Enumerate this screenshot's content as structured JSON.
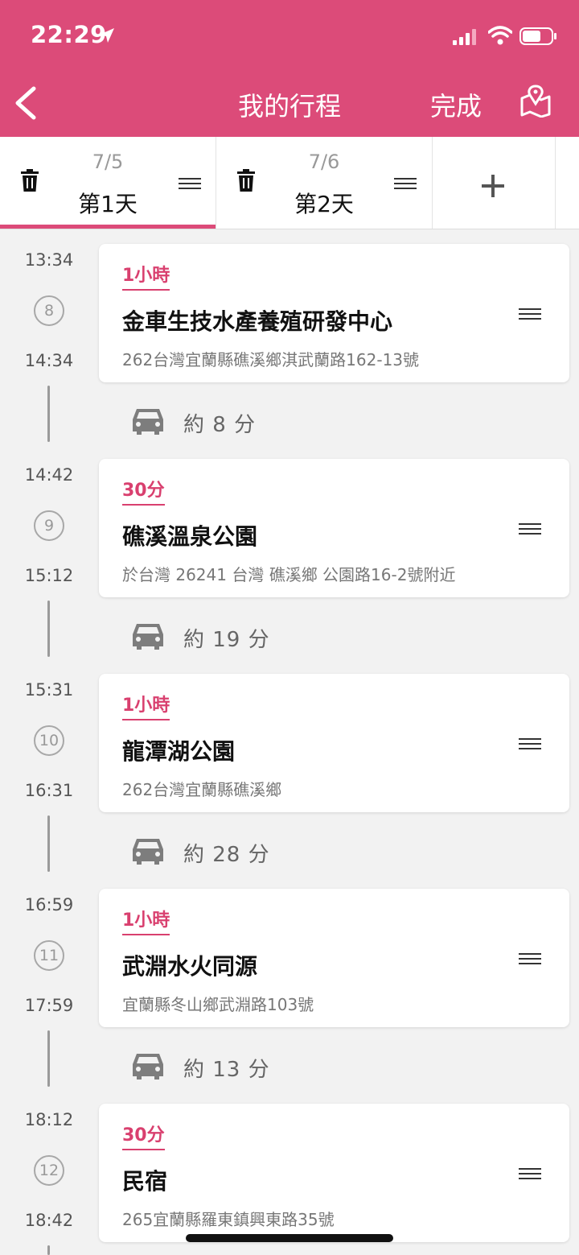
{
  "status": {
    "time": "22:29"
  },
  "header": {
    "title": "我的行程",
    "done_label": "完成"
  },
  "tabs": [
    {
      "date": "7/5",
      "label": "第1天"
    },
    {
      "date": "7/6",
      "label": "第2天"
    }
  ],
  "stops": [
    {
      "number": "8",
      "start": "13:34",
      "end": "14:34",
      "duration": "1小時",
      "name": "金車生技水產養殖研發中心",
      "address": "262台灣宜蘭縣礁溪鄉淇武蘭路162-13號"
    },
    {
      "number": "9",
      "start": "14:42",
      "end": "15:12",
      "duration": "30分",
      "name": "礁溪溫泉公園",
      "address": "於台灣 26241 台灣 礁溪鄉 公園路16-2號附近"
    },
    {
      "number": "10",
      "start": "15:31",
      "end": "16:31",
      "duration": "1小時",
      "name": "龍潭湖公園",
      "address": "262台灣宜蘭縣礁溪鄉"
    },
    {
      "number": "11",
      "start": "16:59",
      "end": "17:59",
      "duration": "1小時",
      "name": "武淵水火同源",
      "address": "宜蘭縣冬山鄉武淵路103號"
    },
    {
      "number": "12",
      "start": "18:12",
      "end": "18:42",
      "duration": "30分",
      "name": "民宿",
      "address": "265宜蘭縣羅東鎮興東路35號"
    }
  ],
  "travel": [
    "約 8 分",
    "約 19 分",
    "約 28 分",
    "約 13 分"
  ],
  "colors": {
    "brand": "#dc4b79",
    "duration": "#d9406f",
    "background": "#f2f2f2"
  }
}
